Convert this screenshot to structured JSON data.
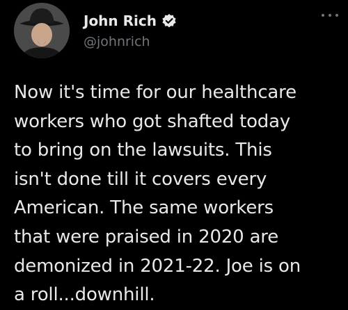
{
  "author": {
    "display_name": "John Rich",
    "handle": "@johnrich",
    "verified": true,
    "avatar_icon": "user-avatar-cowboy-hat"
  },
  "tweet": {
    "lines": [
      "Now it's time for our healthcare",
      "workers who got shafted today",
      "to bring on the lawsuits. This",
      "isn't done till it covers every",
      "American. The same workers",
      "that were praised in 2020 are",
      "demonized in 2021-22. Joe is on",
      "a roll...downhill."
    ]
  },
  "colors": {
    "background": "#000000",
    "text": "#e7e9ea",
    "secondary_text": "#71767b",
    "verified_badge": "#e7e9ea"
  },
  "icons": {
    "more": "more-horizontal-icon",
    "verified": "verified-badge-icon"
  }
}
